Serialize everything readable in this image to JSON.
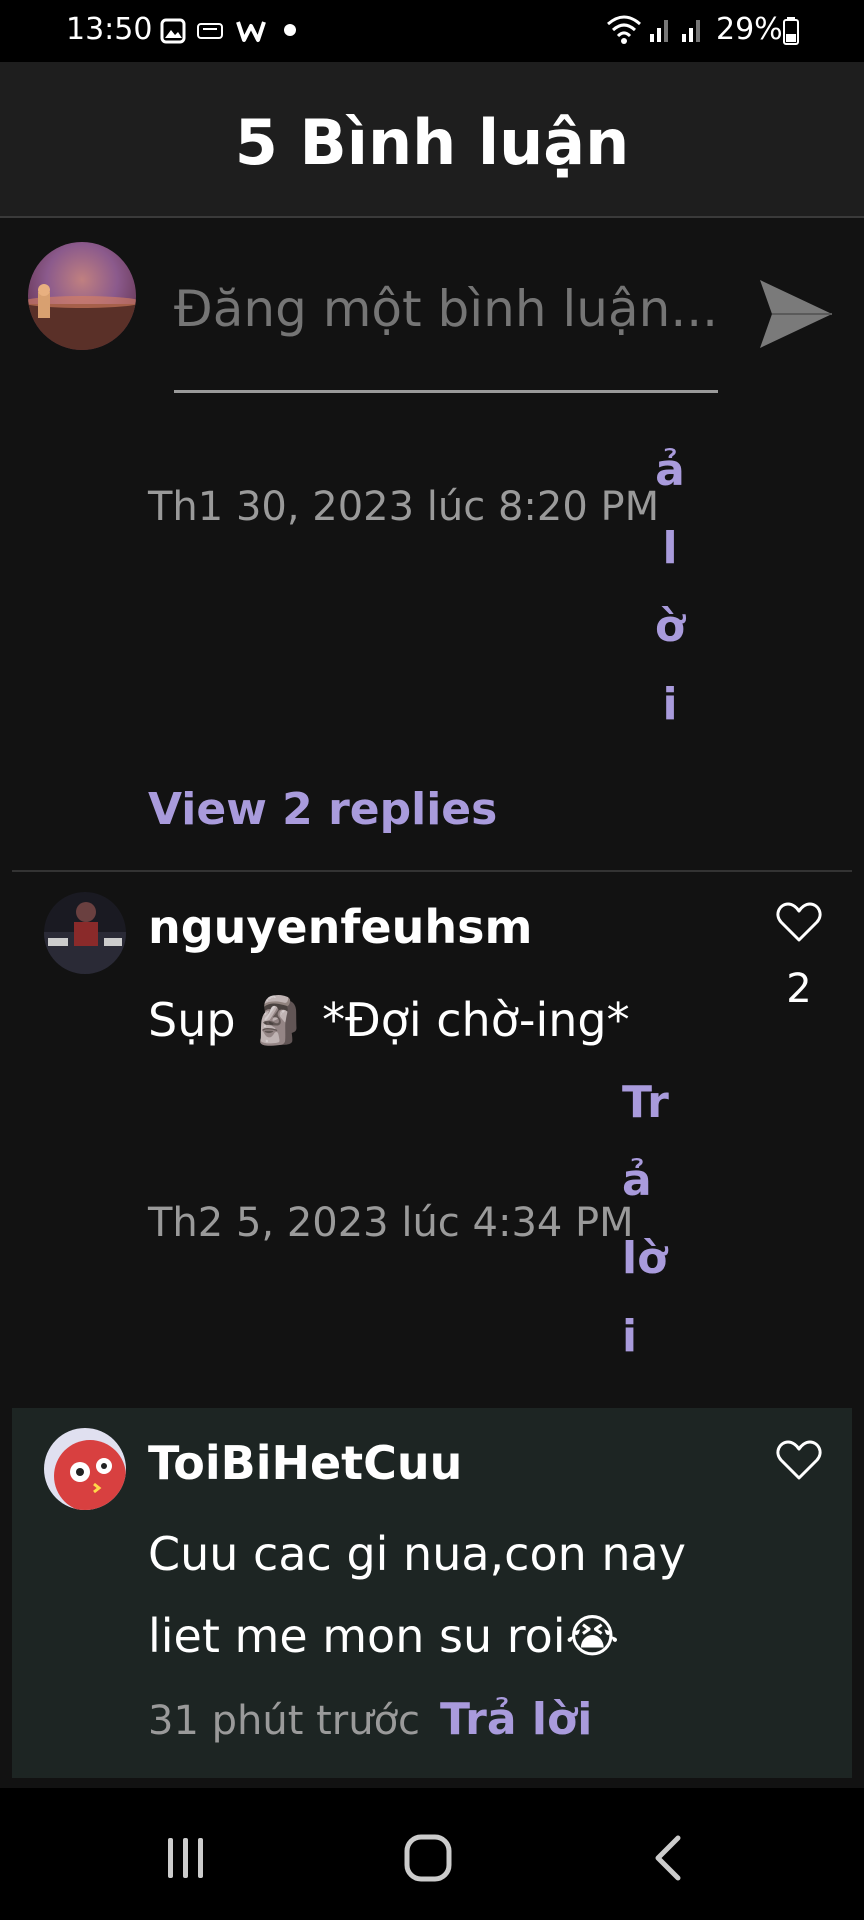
{
  "status_bar": {
    "time": "13:50",
    "battery": "29%"
  },
  "header": {
    "title": "5 Bình luận"
  },
  "composer": {
    "placeholder": "Đăng một bình luận..."
  },
  "comment1": {
    "timestamp": "Th1 30, 2023 lúc 8:20 PM",
    "reply_chars": [
      "ả",
      "l",
      "ờ",
      "i"
    ],
    "view_replies": "View 2 replies"
  },
  "comment2": {
    "username": "nguyenfeuhsm",
    "text": "Sụp 🗿 *Đợi chờ-ing*",
    "likes": "2",
    "timestamp": "Th2 5, 2023 lúc 4:34 PM",
    "reply_chars": [
      "Tr",
      "ả",
      "lờ",
      "i"
    ]
  },
  "comment3": {
    "username": "ToiBiHetCuu",
    "text_line1": "Cuu cac gi nua,con nay",
    "text_line2": "liet me mon su roi😭",
    "timestamp": "31 phút trước",
    "reply": "Trả lời"
  },
  "colors": {
    "accent": "#a99bdc",
    "background": "#121212",
    "header": "#1e1e1e",
    "highlight": "#1d2523"
  }
}
